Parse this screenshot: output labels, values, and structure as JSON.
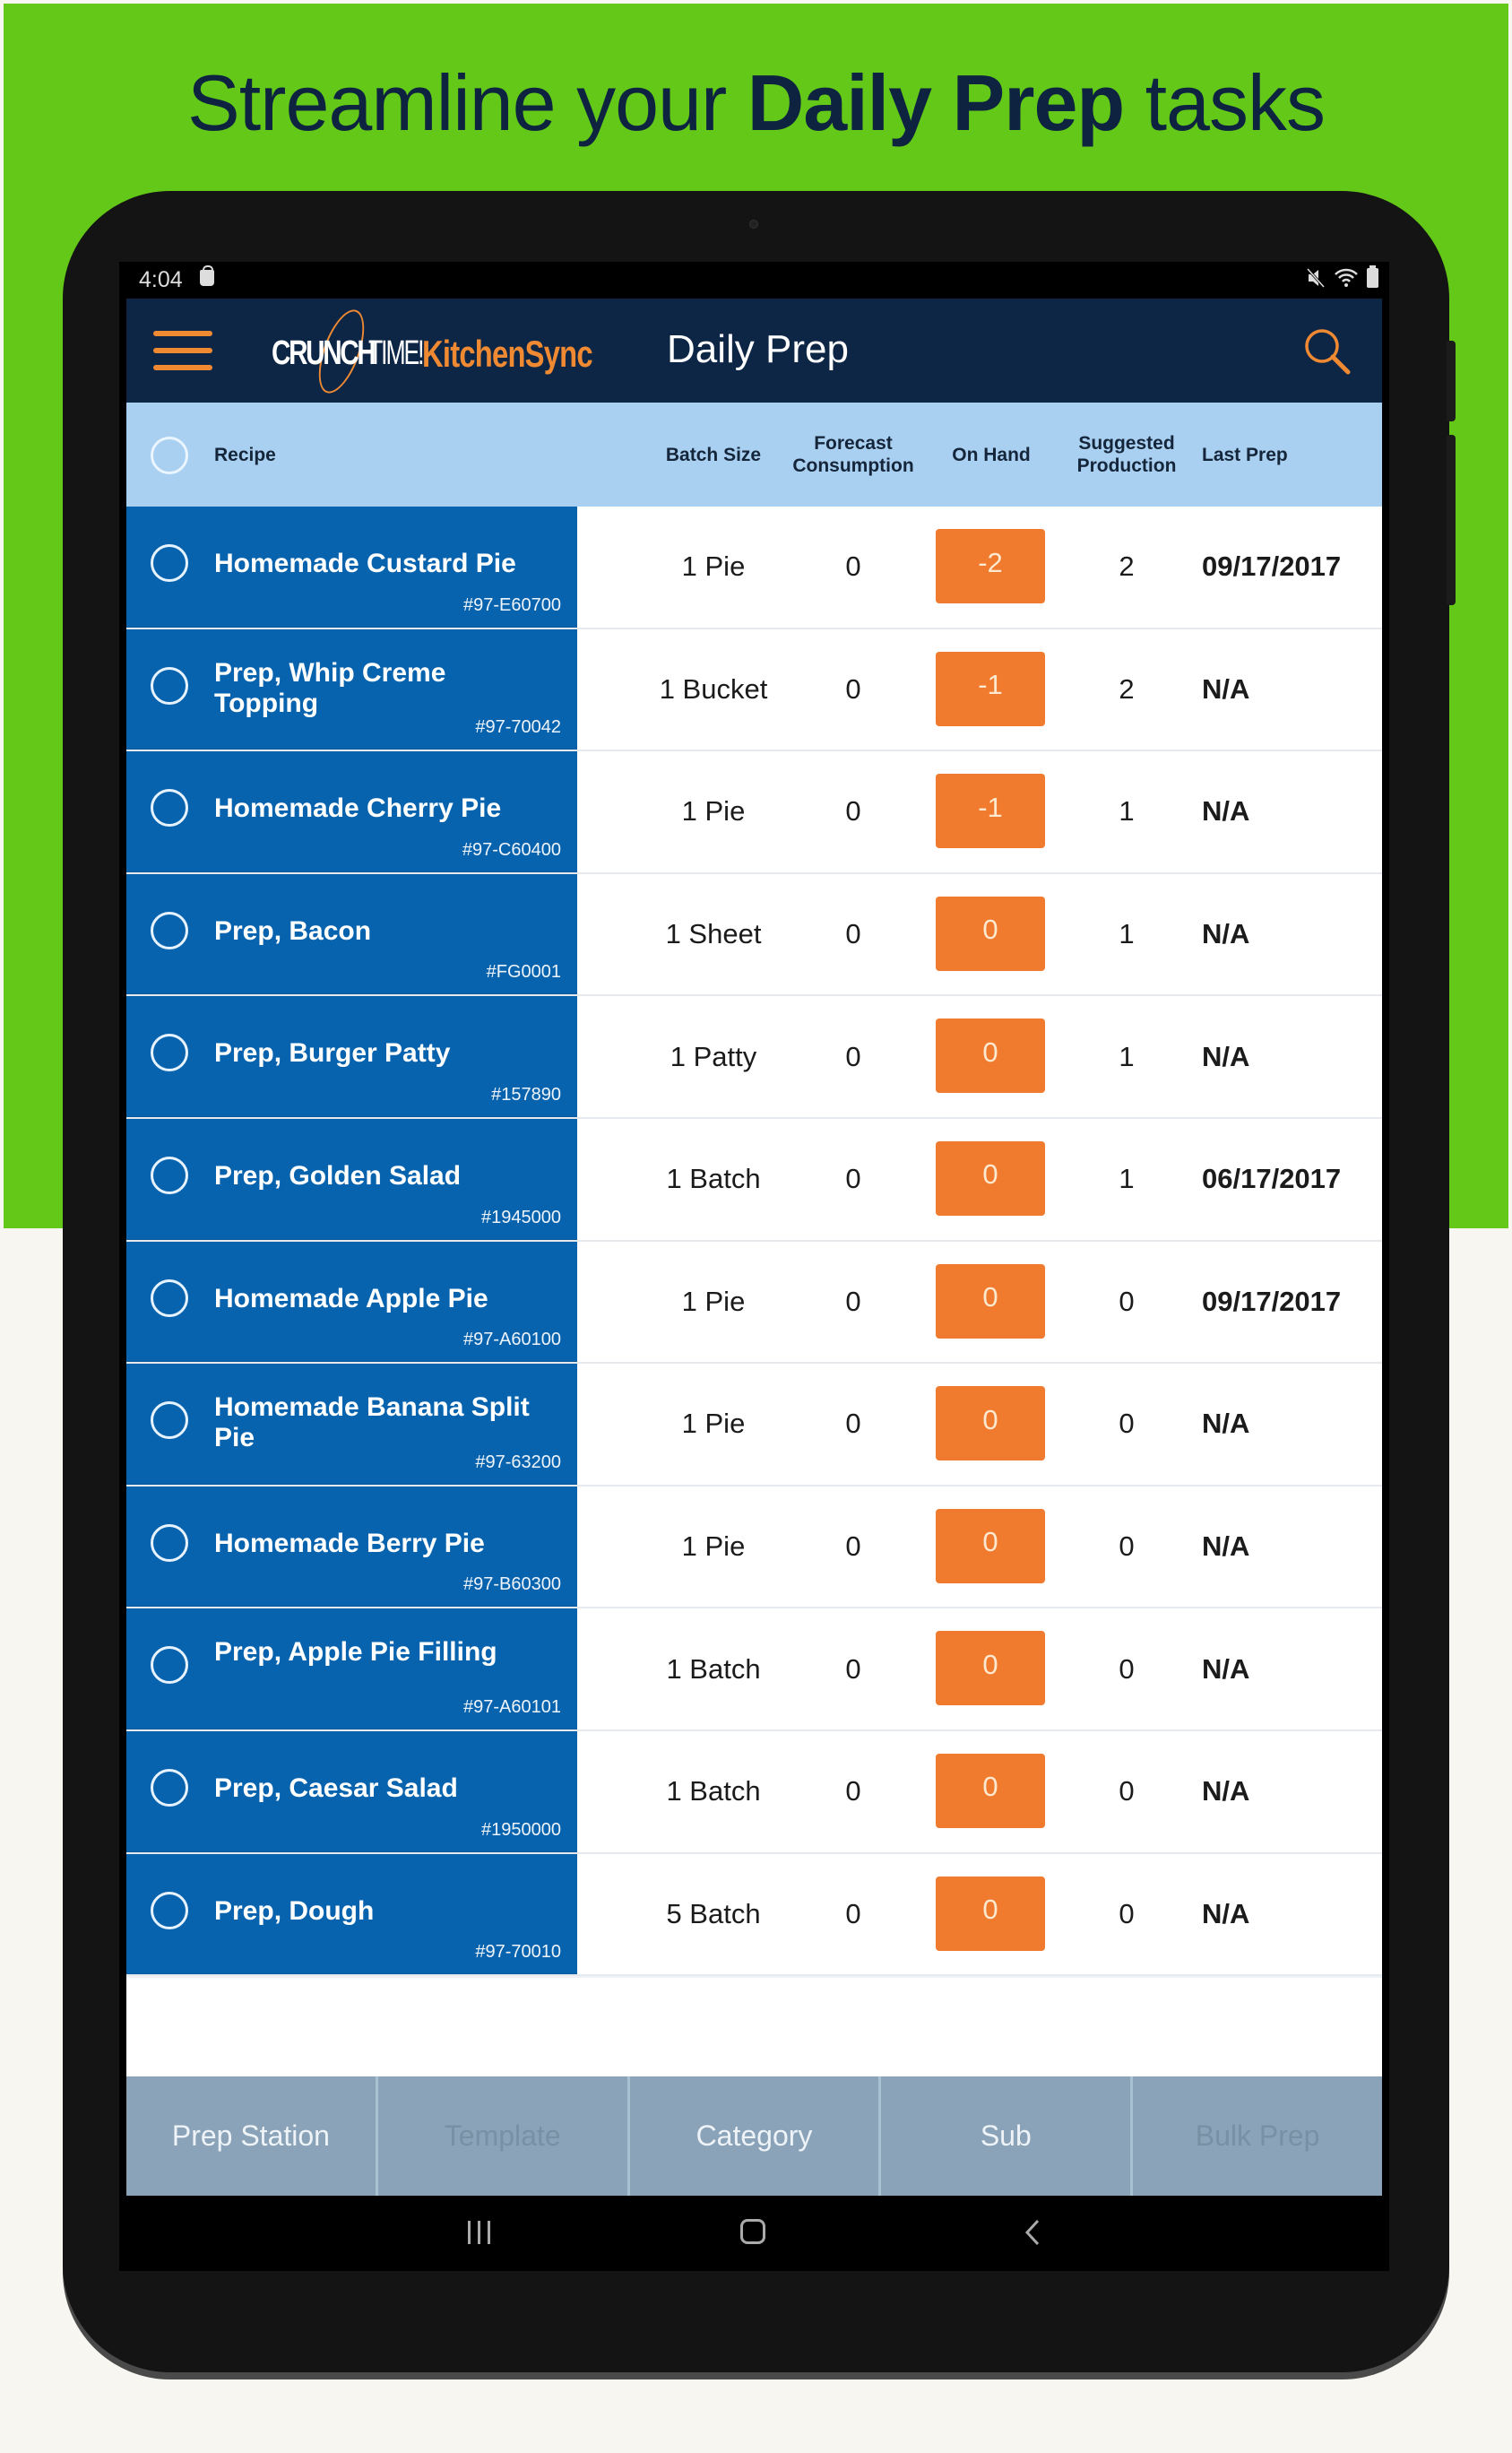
{
  "headline": {
    "prefix": "Streamline your ",
    "bold": "Daily Prep",
    "suffix": " tasks"
  },
  "status_bar": {
    "time": "4:04",
    "icons": [
      "shopping-bag-icon",
      "mute-icon",
      "wifi-icon",
      "battery-icon"
    ]
  },
  "app_bar": {
    "menu_icon": "hamburger-menu-icon",
    "logo": {
      "part1": "CRUNCH",
      "part2": "TIME!",
      "part3": "KitchenSync"
    },
    "title": "Daily Prep",
    "search_icon": "search-icon"
  },
  "columns": {
    "recipe": "Recipe",
    "batch_size": "Batch Size",
    "forecast_line1": "Forecast",
    "forecast_line2": "Consumption",
    "on_hand": "On Hand",
    "suggested_line1": "Suggested",
    "suggested_line2": "Production",
    "last_prep": "Last Prep"
  },
  "rows": [
    {
      "name": "Homemade Custard Pie",
      "id": "#97-E60700",
      "batch_size": "1 Pie",
      "forecast": "0",
      "on_hand": "-2",
      "suggested": "2",
      "last_prep": "09/17/2017"
    },
    {
      "name": "Prep, Whip Creme Topping",
      "id": "#97-70042",
      "batch_size": "1 Bucket",
      "forecast": "0",
      "on_hand": "-1",
      "suggested": "2",
      "last_prep": "N/A"
    },
    {
      "name": "Homemade Cherry Pie",
      "id": "#97-C60400",
      "batch_size": "1 Pie",
      "forecast": "0",
      "on_hand": "-1",
      "suggested": "1",
      "last_prep": "N/A"
    },
    {
      "name": "Prep, Bacon",
      "id": "#FG0001",
      "batch_size": "1 Sheet",
      "forecast": "0",
      "on_hand": "0",
      "suggested": "1",
      "last_prep": "N/A"
    },
    {
      "name": "Prep, Burger Patty",
      "id": "#157890",
      "batch_size": "1 Patty",
      "forecast": "0",
      "on_hand": "0",
      "suggested": "1",
      "last_prep": "N/A"
    },
    {
      "name": "Prep, Golden Salad",
      "id": "#1945000",
      "batch_size": "1 Batch",
      "forecast": "0",
      "on_hand": "0",
      "suggested": "1",
      "last_prep": "06/17/2017"
    },
    {
      "name": "Homemade Apple Pie",
      "id": "#97-A60100",
      "batch_size": "1 Pie",
      "forecast": "0",
      "on_hand": "0",
      "suggested": "0",
      "last_prep": "09/17/2017"
    },
    {
      "name": "Homemade Banana Split Pie",
      "id": "#97-63200",
      "batch_size": "1 Pie",
      "forecast": "0",
      "on_hand": "0",
      "suggested": "0",
      "last_prep": "N/A"
    },
    {
      "name": "Homemade Berry Pie",
      "id": "#97-B60300",
      "batch_size": "1 Pie",
      "forecast": "0",
      "on_hand": "0",
      "suggested": "0",
      "last_prep": "N/A"
    },
    {
      "name": "Prep, Apple Pie Filling",
      "id": "#97-A60101",
      "batch_size": "1 Batch",
      "forecast": "0",
      "on_hand": "0",
      "suggested": "0",
      "last_prep": "N/A"
    },
    {
      "name": "Prep, Caesar Salad",
      "id": "#1950000",
      "batch_size": "1 Batch",
      "forecast": "0",
      "on_hand": "0",
      "suggested": "0",
      "last_prep": "N/A"
    },
    {
      "name": "Prep, Dough",
      "id": "#97-70010",
      "batch_size": "5 Batch",
      "forecast": "0",
      "on_hand": "0",
      "suggested": "0",
      "last_prep": "N/A"
    }
  ],
  "tabs": [
    {
      "label": "Prep Station",
      "enabled": true
    },
    {
      "label": "Template",
      "enabled": false
    },
    {
      "label": "Category",
      "enabled": true
    },
    {
      "label": "Sub",
      "enabled": true
    },
    {
      "label": "Bulk Prep",
      "enabled": false
    }
  ],
  "nav_bar": {
    "icons": [
      "recent-apps-icon",
      "home-icon",
      "back-icon"
    ]
  },
  "colors": {
    "background_green": "#63c818",
    "app_bar": "#0d2645",
    "column_header": "#a9d0f1",
    "recipe_cell": "#0863ae",
    "on_hand_badge": "#f07a2e",
    "accent_orange": "#ef8a33",
    "tab_bar": "#8aa3b8"
  }
}
